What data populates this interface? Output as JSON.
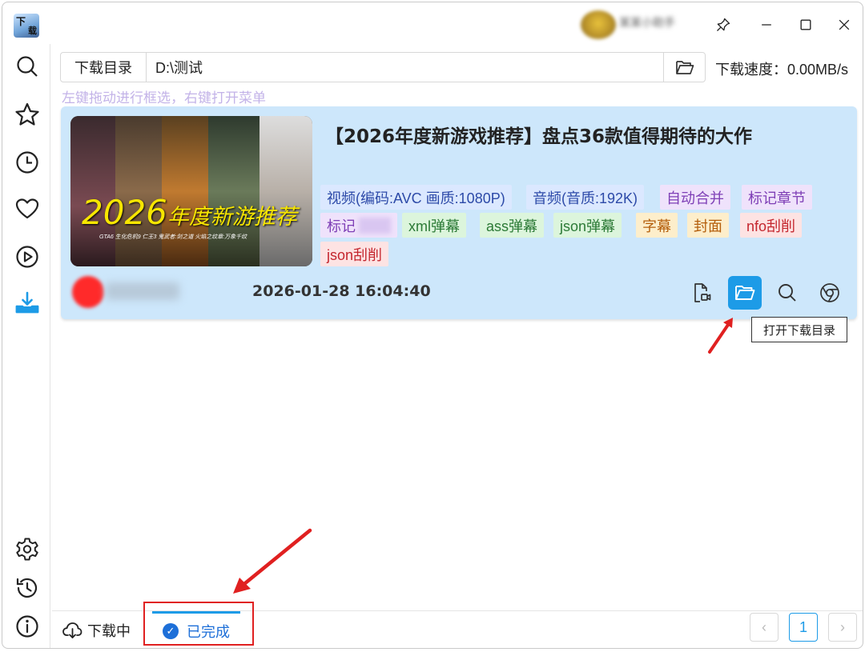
{
  "window": {
    "user_name": "某某小助手",
    "controls": [
      "pin-icon",
      "minimize-icon",
      "maximize-icon",
      "close-icon"
    ]
  },
  "sidebar": {
    "items": [
      {
        "icon": "search-icon"
      },
      {
        "icon": "star-icon"
      },
      {
        "icon": "clock-icon"
      },
      {
        "icon": "heart-icon"
      },
      {
        "icon": "play-icon"
      },
      {
        "icon": "download-icon",
        "active": true
      }
    ],
    "bottom": [
      {
        "icon": "gear-icon"
      },
      {
        "icon": "history-icon"
      },
      {
        "icon": "info-icon"
      }
    ]
  },
  "pathbar": {
    "label": "下载目录",
    "value": "D:\\测试",
    "folder_icon": "folder-open-icon"
  },
  "speed": "下载速度：0.00MB/s",
  "hint": "左键拖动进行框选，右键打开菜单",
  "card": {
    "cover": {
      "title_big": "2026",
      "title_small": "年度新游推荐",
      "subtitle": "GTA6  生化危机9  仁王3  鬼武者:剑之道  火焰之纹章:万象千纹"
    },
    "title": "【2026年度新游戏推荐】盘点36款值得期待的大作",
    "tags": [
      {
        "text": "视频(编码:AVC 画质:1080P)",
        "color": "blue"
      },
      {
        "text": "音频(音质:192K)",
        "color": "blue"
      },
      {
        "text": "自动合并",
        "color": "purple"
      },
      {
        "text": "标记章节",
        "color": "purple"
      },
      {
        "text": "标记",
        "color": "purple"
      },
      {
        "text": "xml弹幕",
        "color": "green"
      },
      {
        "text": "ass弹幕",
        "color": "green"
      },
      {
        "text": "json弹幕",
        "color": "green"
      },
      {
        "text": "字幕",
        "color": "orange"
      },
      {
        "text": "封面",
        "color": "orange"
      },
      {
        "text": "nfo刮削",
        "color": "red"
      },
      {
        "text": "json刮削",
        "color": "red"
      }
    ],
    "uploader": "",
    "datetime": "2026-01-28 16:04:40",
    "actions": [
      "file-video-icon",
      "folder-open-icon",
      "search-icon",
      "chrome-icon"
    ]
  },
  "tooltip": "打开下载目录",
  "bottombar": {
    "tab_downloading": "下载中",
    "tab_done": "已完成",
    "page": "1",
    "prev": "‹",
    "next": "›"
  },
  "colors": {
    "accent": "#1d9be7",
    "card_bg": "#cde7fb",
    "annotation": "#e02020"
  }
}
